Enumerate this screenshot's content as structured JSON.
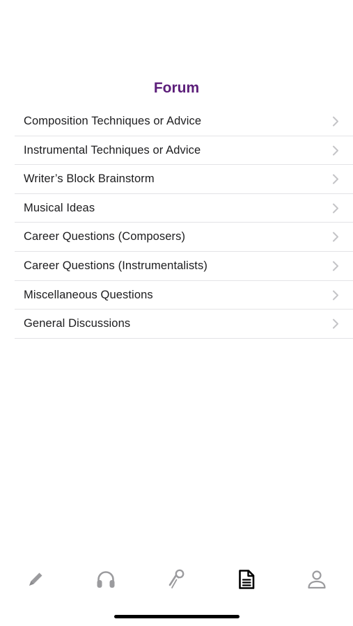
{
  "header": {
    "title": "Forum"
  },
  "forum": {
    "items": [
      {
        "label": "Composition Techniques or Advice"
      },
      {
        "label": "Instrumental Techniques or Advice"
      },
      {
        "label": "Writer’s Block Brainstorm"
      },
      {
        "label": "Musical Ideas"
      },
      {
        "label": "Career Questions (Composers)"
      },
      {
        "label": "Career Questions (Instrumentalists)"
      },
      {
        "label": "Miscellaneous Questions"
      },
      {
        "label": "General Discussions"
      }
    ]
  },
  "tab_bar": {
    "tabs": [
      {
        "icon": "pencil-icon",
        "active": false
      },
      {
        "icon": "headphones-icon",
        "active": false
      },
      {
        "icon": "microphone-icon",
        "active": false
      },
      {
        "icon": "document-icon",
        "active": true
      },
      {
        "icon": "person-icon",
        "active": false
      }
    ]
  },
  "colors": {
    "accent": "#5c1e7a",
    "text": "#1c1c1e",
    "chevron": "#c4c4c7",
    "separator": "#e3e3e6",
    "tab_inactive": "#9b9b9e",
    "tab_active": "#000000"
  }
}
